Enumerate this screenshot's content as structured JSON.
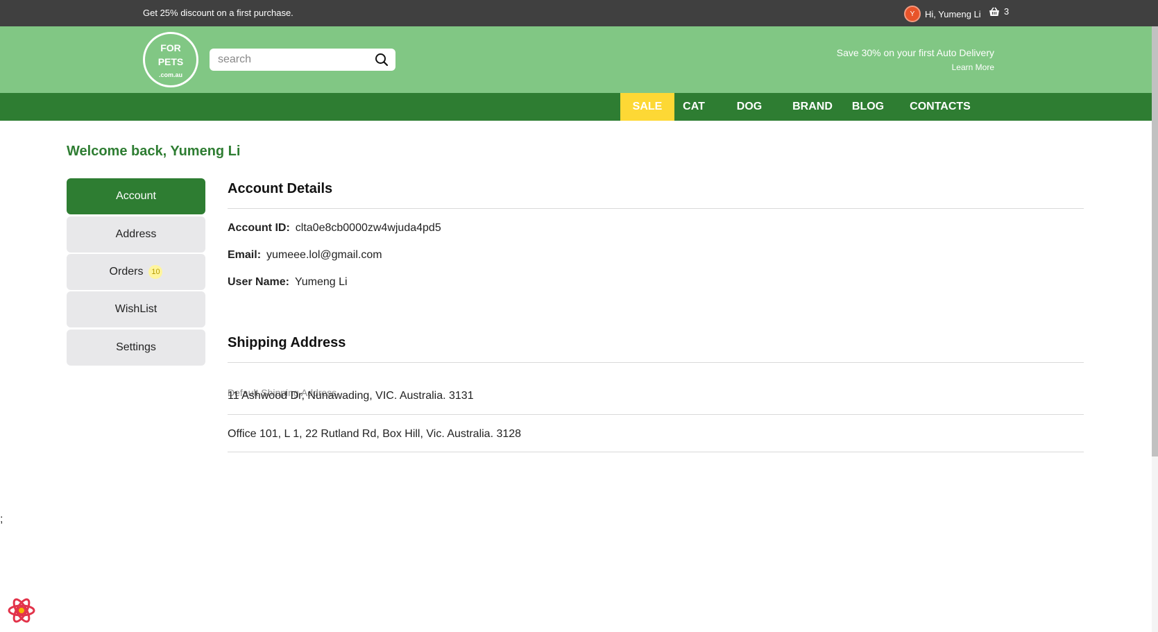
{
  "topbar": {
    "promo": "Get 25% discount on a first purchase.",
    "avatar_initial": "Y",
    "greeting": "Hi, Yumeng Li",
    "cart_count": "3"
  },
  "header": {
    "logo_line1": "FOR",
    "logo_line2": "PETS",
    "logo_line3": ".com.au",
    "search_placeholder": "search",
    "auto_delivery": "Save 30% on your first Auto Delivery",
    "learn_more": "Learn More"
  },
  "nav": {
    "sale": "SALE",
    "cat": "CAT",
    "dog": "DOG",
    "brand": "BRAND",
    "blog": "BLOG",
    "contacts": "CONTACTS"
  },
  "welcome": "Welcome back, Yumeng Li",
  "sidebar": {
    "account": "Account",
    "address": "Address",
    "orders": "Orders",
    "orders_count": "10",
    "wishlist": "WishList",
    "settings": "Settings"
  },
  "account_details": {
    "title": "Account Details",
    "id_label": "Account ID:",
    "id_value": "clta0e8cb0000zw4wjuda4pd5",
    "email_label": "Email:",
    "email_value": "yumeee.lol@gmail.com",
    "username_label": "User Name:",
    "username_value": "Yumeng Li"
  },
  "shipping": {
    "title": "Shipping Address",
    "default_label": "Default Shipping Address",
    "address1": "11 Ashwood Dr, Nunawading, VIC. Australia. 3131",
    "address2": "Office 101, L 1, 22 Rutland Rd, Box Hill, Vic. Australia. 3128"
  },
  "stray_text": ";",
  "colors": {
    "topbar": "#404040",
    "header": "#81c784",
    "nav": "#2e7d32",
    "sale": "#fdd835",
    "accent": "#2e7d32"
  }
}
